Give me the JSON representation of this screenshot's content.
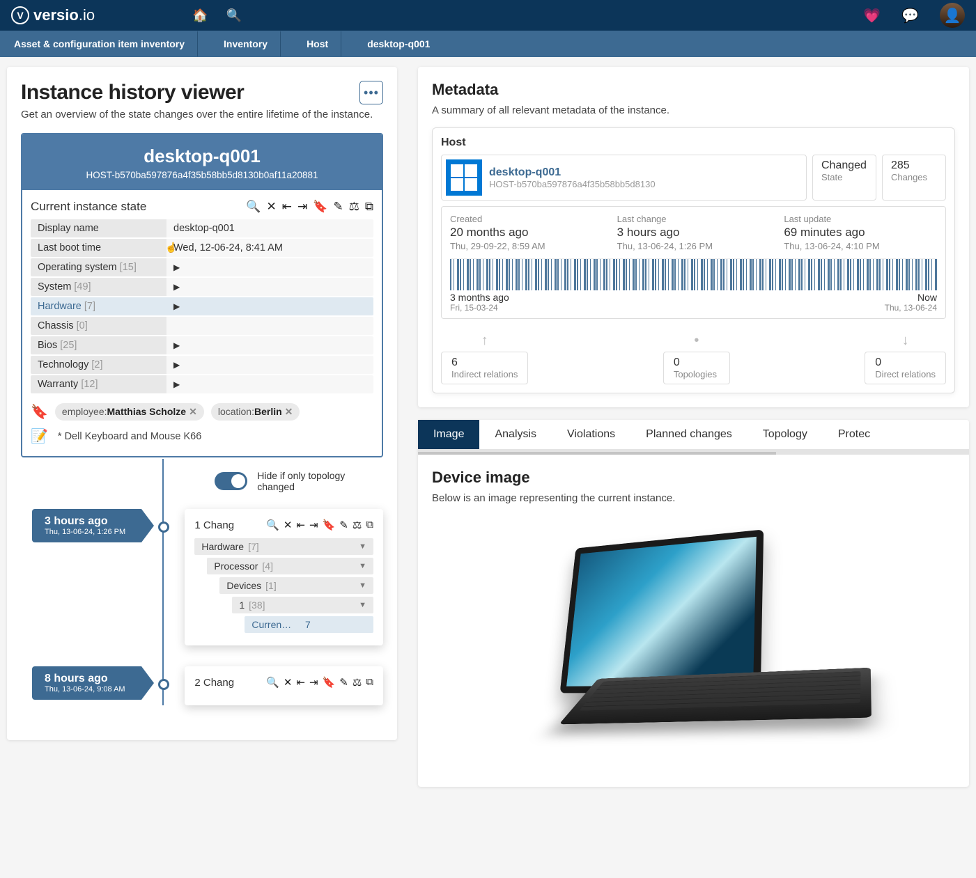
{
  "topbar": {
    "logo_bold": "versio",
    "logo_light": ".io"
  },
  "breadcrumb": [
    "Asset & configuration item inventory",
    "Inventory",
    "Host",
    "desktop-q001"
  ],
  "left": {
    "title": "Instance history viewer",
    "subtitle": "Get an overview of the state changes over the entire lifetime of the instance.",
    "inst_name": "desktop-q001",
    "inst_id": "HOST-b570ba597876a4f35b58bb5d8130b0af11a20881",
    "state_title": "Current instance state",
    "props": [
      {
        "k": "Display name",
        "v": "desktop-q001",
        "expand": false
      },
      {
        "k": "Last boot time",
        "v": "Wed, 12-06-24, 8:41 AM",
        "expand": false
      },
      {
        "k": "Operating system",
        "c": "[15]",
        "v": "",
        "expand": true
      },
      {
        "k": "System",
        "c": "[49]",
        "v": "",
        "expand": true
      },
      {
        "k": "Hardware",
        "c": "[7]",
        "v": "",
        "expand": true,
        "hl": true
      },
      {
        "k": "Chassis",
        "c": "[0]",
        "v": "",
        "expand": false
      },
      {
        "k": "Bios",
        "c": "[25]",
        "v": "",
        "expand": true
      },
      {
        "k": "Technology",
        "c": "[2]",
        "v": "",
        "expand": true
      },
      {
        "k": "Warranty",
        "c": "[12]",
        "v": "",
        "expand": true
      }
    ],
    "tags": [
      {
        "key": "employee:",
        "val": "Matthias Scholze"
      },
      {
        "key": "location:",
        "val": "Berlin"
      }
    ],
    "note": "* Dell Keyboard and Mouse K66",
    "toggle_label": "Hide if only topology changed",
    "tl": [
      {
        "ago": "3 hours ago",
        "ts": "Thu, 13-06-24, 1:26 PM",
        "change_title": "1 Chang",
        "tree": [
          {
            "lvl": 0,
            "t": "Hardware",
            "c": "[7]"
          },
          {
            "lvl": 1,
            "t": "Processor",
            "c": "[4]"
          },
          {
            "lvl": 2,
            "t": "Devices",
            "c": "[1]"
          },
          {
            "lvl": 3,
            "t": "1",
            "c": "[38]"
          },
          {
            "lvl": 4,
            "t": "Curren…",
            "v": "7"
          }
        ]
      },
      {
        "ago": "8 hours ago",
        "ts": "Thu, 13-06-24, 9:08 AM",
        "change_title": "2 Chang"
      }
    ]
  },
  "right": {
    "meta_title": "Metadata",
    "meta_sub": "A summary of all relevant metadata of the instance.",
    "host_label": "Host",
    "host_name": "desktop-q001",
    "host_id": "HOST-b570ba597876a4f35b58bb5d8130",
    "stat1_main": "Changed",
    "stat1_sub": "State",
    "stat2_main": "285",
    "stat2_sub": "Changes",
    "times": [
      {
        "label": "Created",
        "main": "20 months ago",
        "sub": "Thu, 29-09-22, 8:59 AM"
      },
      {
        "label": "Last change",
        "main": "3 hours ago",
        "sub": "Thu, 13-06-24, 1:26 PM"
      },
      {
        "label": "Last update",
        "main": "69 minutes ago",
        "sub": "Thu, 13-06-24, 4:10 PM"
      }
    ],
    "bc_left": "3 months ago",
    "bc_right": "Now",
    "bc_left_sub": "Fri, 15-03-24",
    "bc_right_sub": "Thu, 13-06-24",
    "rels": [
      {
        "arrow": "↑",
        "n": "6",
        "l": "Indirect relations"
      },
      {
        "arrow": "•",
        "n": "0",
        "l": "Topologies"
      },
      {
        "arrow": "↓",
        "n": "0",
        "l": "Direct relations"
      }
    ],
    "tabs": [
      "Image",
      "Analysis",
      "Violations",
      "Planned changes",
      "Topology",
      "Protec"
    ],
    "dev_title": "Device image",
    "dev_sub": "Below is an image representing the current instance."
  }
}
